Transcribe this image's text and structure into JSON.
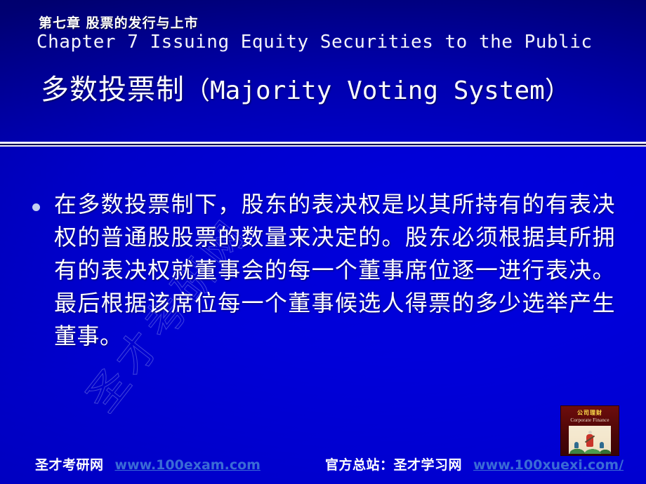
{
  "slide": {
    "chapter_cn": "第七章  股票的发行与上市",
    "chapter_en": "Chapter 7 Issuing Equity Securities to the Public",
    "title_cn": "多数投票制",
    "title_en": "（Majority Voting System）",
    "bullet_text": "在多数投票制下，股东的表决权是以其所持有的有表决权的普通股股票的数量来决定的。股东必须根据其所拥有的表决权就董事会的每一个董事席位逐一进行表决。最后根据该席位每一个董事候选人得票的多少选举产生董事。",
    "watermark_text": "圣才考研网"
  },
  "book_cover": {
    "title_cn": "公司理财",
    "title_en": "Corporate Finance"
  },
  "footer": {
    "left_label": "圣才考研网",
    "left_link": "www.100exam.com",
    "right_label": "官方总站：圣才学习网",
    "right_link": "www.100xuexi.com/"
  },
  "colors": {
    "background_blue": "#0000a0",
    "header_dark": "#000058",
    "divider_white": "#f2f2f8",
    "text_white": "#ffffff",
    "link_blue": "#3a6bd6",
    "bullet_dot": "#c2cff0",
    "cover_red": "#4a0606",
    "cover_gold": "#ffe14d"
  }
}
